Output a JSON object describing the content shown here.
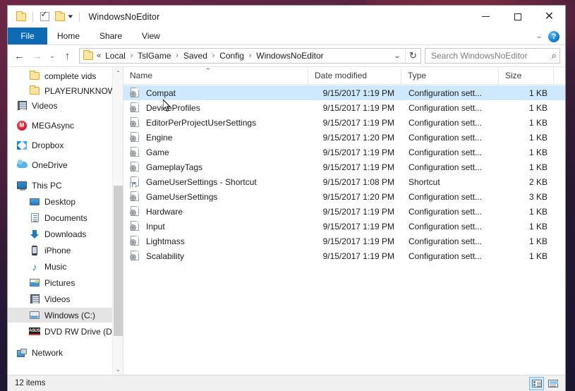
{
  "window": {
    "title": "WindowsNoEditor",
    "quick_access": {
      "folder_icon": "folder-icon",
      "properties_icon": "properties-checkbox-icon",
      "new_folder_icon": "new-folder-icon",
      "customize_caret": "▾"
    },
    "controls": {
      "minimize": "minimize-icon",
      "maximize": "maximize-icon",
      "close": "✕"
    }
  },
  "ribbon": {
    "tabs": [
      {
        "label": "File",
        "active": true
      },
      {
        "label": "Home",
        "active": false
      },
      {
        "label": "Share",
        "active": false
      },
      {
        "label": "View",
        "active": false
      }
    ],
    "expand_caret": "⌄",
    "help_label": "?"
  },
  "navigation": {
    "back": "←",
    "forward": "→",
    "recent": "⌄",
    "up": "↑",
    "breadcrumb": {
      "prefix": "«",
      "items": [
        "Local",
        "TslGame",
        "Saved",
        "Config",
        "WindowsNoEditor"
      ],
      "separator": "›",
      "dropdown_caret": "⌄",
      "refresh": "↻"
    },
    "search": {
      "value": "",
      "placeholder": "Search WindowsNoEditor",
      "icon": "search-icon"
    }
  },
  "sidebar": {
    "scroll": {
      "up_arrow": "⌃",
      "down_arrow": "⌄"
    },
    "items": [
      {
        "label": "complete vids",
        "icon": "folder-icon",
        "indent": "sub",
        "selected": false
      },
      {
        "label": "PLAYERUNKNOW",
        "icon": "folder-icon",
        "indent": "sub",
        "selected": false
      },
      {
        "label": "Videos",
        "icon": "videos-icon",
        "indent": "2",
        "selected": false
      },
      {
        "label": "MEGAsync",
        "icon": "megasync-icon",
        "indent": "0",
        "selected": false
      },
      {
        "label": "Dropbox",
        "icon": "dropbox-icon",
        "indent": "0",
        "selected": false
      },
      {
        "label": "OneDrive",
        "icon": "onedrive-icon",
        "indent": "0",
        "selected": false
      },
      {
        "label": "This PC",
        "icon": "this-pc-icon",
        "indent": "0",
        "selected": false
      },
      {
        "label": "Desktop",
        "icon": "desktop-icon",
        "indent": "2",
        "selected": false
      },
      {
        "label": "Documents",
        "icon": "documents-icon",
        "indent": "2",
        "selected": false
      },
      {
        "label": "Downloads",
        "icon": "downloads-icon",
        "indent": "2",
        "selected": false
      },
      {
        "label": "iPhone",
        "icon": "iphone-icon",
        "indent": "2",
        "selected": false
      },
      {
        "label": "Music",
        "icon": "music-icon",
        "indent": "2",
        "selected": false
      },
      {
        "label": "Pictures",
        "icon": "pictures-icon",
        "indent": "2",
        "selected": false
      },
      {
        "label": "Videos",
        "icon": "videos-icon",
        "indent": "2",
        "selected": false
      },
      {
        "label": "Windows (C:)",
        "icon": "drive-icon",
        "indent": "2",
        "selected": true
      },
      {
        "label": "DVD RW Drive (D",
        "icon": "asus-dvd-icon",
        "indent": "2",
        "selected": false
      },
      {
        "label": "Network",
        "icon": "network-icon",
        "indent": "0",
        "selected": false
      }
    ]
  },
  "filelist": {
    "columns": [
      {
        "label": "Name",
        "key": "name"
      },
      {
        "label": "Date modified",
        "key": "date"
      },
      {
        "label": "Type",
        "key": "type"
      },
      {
        "label": "Size",
        "key": "size"
      }
    ],
    "sort_indicator": "⌃",
    "rows": [
      {
        "name": "Compat",
        "date": "9/15/2017 1:19 PM",
        "type": "Configuration sett...",
        "size": "1 KB",
        "icon": "config-file-icon",
        "selected": true
      },
      {
        "name": "DeviceProfiles",
        "date": "9/15/2017 1:19 PM",
        "type": "Configuration sett...",
        "size": "1 KB",
        "icon": "config-file-icon",
        "selected": false
      },
      {
        "name": "EditorPerProjectUserSettings",
        "date": "9/15/2017 1:19 PM",
        "type": "Configuration sett...",
        "size": "1 KB",
        "icon": "config-file-icon",
        "selected": false
      },
      {
        "name": "Engine",
        "date": "9/15/2017 1:20 PM",
        "type": "Configuration sett...",
        "size": "1 KB",
        "icon": "config-file-icon",
        "selected": false
      },
      {
        "name": "Game",
        "date": "9/15/2017 1:19 PM",
        "type": "Configuration sett...",
        "size": "1 KB",
        "icon": "config-file-icon",
        "selected": false
      },
      {
        "name": "GameplayTags",
        "date": "9/15/2017 1:19 PM",
        "type": "Configuration sett...",
        "size": "1 KB",
        "icon": "config-file-icon",
        "selected": false
      },
      {
        "name": "GameUserSettings - Shortcut",
        "date": "9/15/2017 1:08 PM",
        "type": "Shortcut",
        "size": "2 KB",
        "icon": "shortcut-file-icon",
        "selected": false
      },
      {
        "name": "GameUserSettings",
        "date": "9/15/2017 1:20 PM",
        "type": "Configuration sett...",
        "size": "3 KB",
        "icon": "config-file-icon",
        "selected": false
      },
      {
        "name": "Hardware",
        "date": "9/15/2017 1:19 PM",
        "type": "Configuration sett...",
        "size": "1 KB",
        "icon": "config-file-icon",
        "selected": false
      },
      {
        "name": "Input",
        "date": "9/15/2017 1:19 PM",
        "type": "Configuration sett...",
        "size": "1 KB",
        "icon": "config-file-icon",
        "selected": false
      },
      {
        "name": "Lightmass",
        "date": "9/15/2017 1:19 PM",
        "type": "Configuration sett...",
        "size": "1 KB",
        "icon": "config-file-icon",
        "selected": false
      },
      {
        "name": "Scalability",
        "date": "9/15/2017 1:19 PM",
        "type": "Configuration sett...",
        "size": "1 KB",
        "icon": "config-file-icon",
        "selected": false
      }
    ]
  },
  "statusbar": {
    "item_count": "12 items",
    "views": [
      {
        "name": "details-view",
        "active": true
      },
      {
        "name": "large-icons-view",
        "active": false
      }
    ]
  },
  "colors": {
    "accent": "#0d6bb5",
    "selection": "#cde8ff",
    "desktop": "#5a2440"
  }
}
